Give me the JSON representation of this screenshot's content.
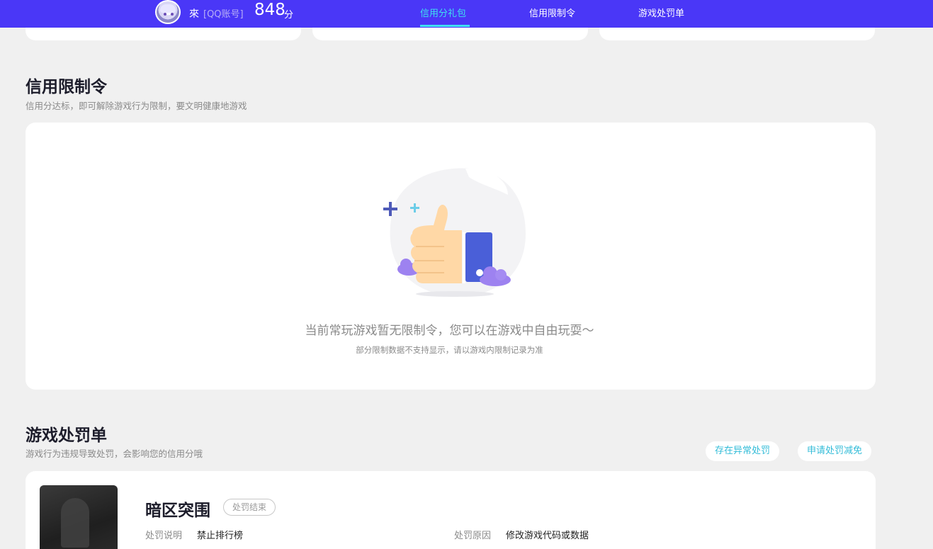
{
  "header": {
    "username": "來",
    "account_type": "[QQ账号]",
    "score": "848",
    "score_unit": "分",
    "tabs": [
      {
        "label": "信用分礼包",
        "active": true
      },
      {
        "label": "信用限制令",
        "active": false
      },
      {
        "label": "游戏处罚单",
        "active": false
      }
    ]
  },
  "restriction": {
    "title": "信用限制令",
    "subtitle": "信用分达标，即可解除游戏行为限制，要文明健康地游戏",
    "empty_main": "当前常玩游戏暂无限制令，您可以在游戏中自由玩耍～",
    "empty_sub": "部分限制数据不支持显示，请以游戏内限制记录为准"
  },
  "penalty": {
    "title": "游戏处罚单",
    "subtitle": "游戏行为违规导致处罚，会影响您的信用分哦",
    "btn_abnormal": "存在异常处罚",
    "btn_appeal": "申请处罚减免",
    "items": [
      {
        "game": "暗区突围",
        "status": "处罚结束",
        "desc_label": "处罚说明",
        "desc_value": "禁止排行榜",
        "reason_label": "处罚原因",
        "reason_value": "修改游戏代码或数据"
      }
    ]
  },
  "colors": {
    "brand": "#4a37f7",
    "accent": "#3fe0f0",
    "link": "#33bcd8"
  },
  "icons": {
    "empty_state": "thumbs-up-illustration"
  }
}
